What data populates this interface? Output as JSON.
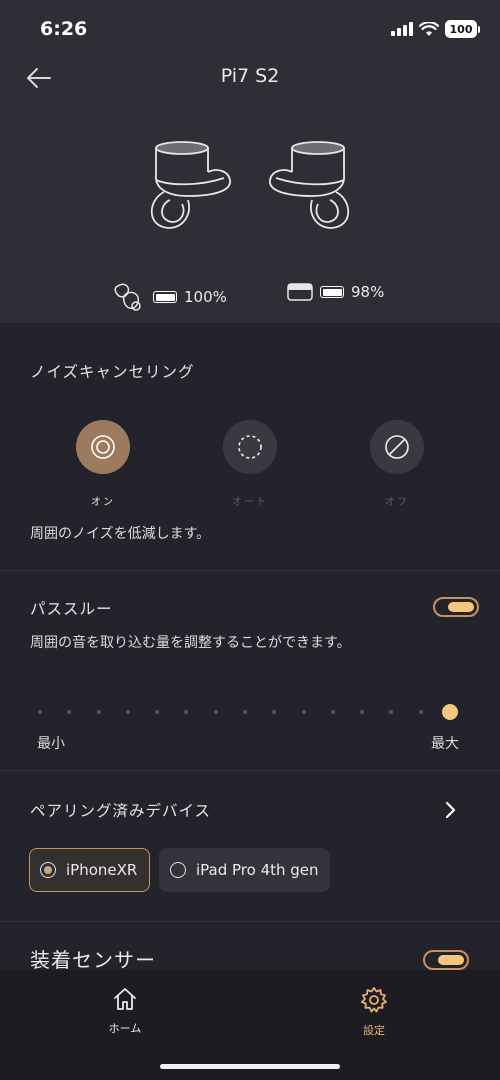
{
  "status": {
    "time": "6:26",
    "battery": "100"
  },
  "header": {
    "title": "Pi7 S2"
  },
  "battery": {
    "earbuds_level": "100%",
    "case_level": "98%"
  },
  "noise_cancelling": {
    "title": "ノイズキャンセリング",
    "options": [
      {
        "label": "オン",
        "icon": "anc-on-icon",
        "active": true
      },
      {
        "label": "オート",
        "icon": "anc-auto-icon",
        "active": false
      },
      {
        "label": "オフ",
        "icon": "anc-off-icon",
        "active": false
      }
    ],
    "description": "周囲のノイズを低減します。"
  },
  "passthrough": {
    "title": "パススルー",
    "enabled": true,
    "description": "周囲の音を取り込む量を調整することができます。",
    "level": 1.0,
    "min_label": "最小",
    "max_label": "最大"
  },
  "paired_devices": {
    "title": "ペアリング済みデバイス",
    "devices": [
      {
        "name": "iPhoneXR",
        "selected": true
      },
      {
        "name": "iPad Pro 4th gen",
        "selected": false
      }
    ]
  },
  "wear_sensor": {
    "title": "装着センサー",
    "enabled": true
  },
  "tabs": [
    {
      "label": "ホーム",
      "icon": "home-icon",
      "active": false
    },
    {
      "label": "設定",
      "icon": "gear-icon",
      "active": true
    }
  ],
  "colors": {
    "accent": "#f5c77e",
    "active_option": "#9d7a5f",
    "toggle_border": "#c9905f"
  }
}
